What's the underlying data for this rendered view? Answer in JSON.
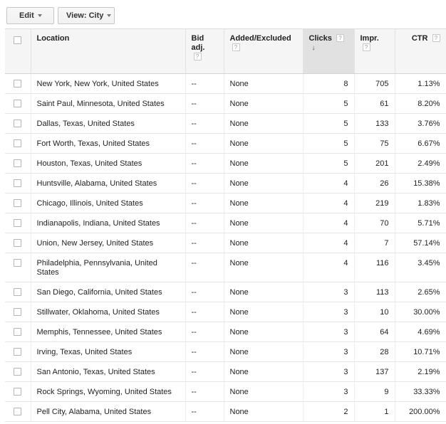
{
  "toolbar": {
    "edit_label": "Edit",
    "view_label": "View: City"
  },
  "table": {
    "headers": {
      "location": "Location",
      "bid_adj": "Bid adj.",
      "added_excluded": "Added/Excluded",
      "clicks": "Clicks",
      "impr": "Impr.",
      "ctr": "CTR"
    },
    "hint_glyph": "?",
    "sort_glyph": "↓",
    "rows": [
      {
        "location": "New York, New York, United States",
        "bid": "--",
        "added": "None",
        "clicks": "8",
        "impr": "705",
        "ctr": "1.13%"
      },
      {
        "location": "Saint Paul, Minnesota, United States",
        "bid": "--",
        "added": "None",
        "clicks": "5",
        "impr": "61",
        "ctr": "8.20%"
      },
      {
        "location": "Dallas, Texas, United States",
        "bid": "--",
        "added": "None",
        "clicks": "5",
        "impr": "133",
        "ctr": "3.76%"
      },
      {
        "location": "Fort Worth, Texas, United States",
        "bid": "--",
        "added": "None",
        "clicks": "5",
        "impr": "75",
        "ctr": "6.67%"
      },
      {
        "location": "Houston, Texas, United States",
        "bid": "--",
        "added": "None",
        "clicks": "5",
        "impr": "201",
        "ctr": "2.49%"
      },
      {
        "location": "Huntsville, Alabama, United States",
        "bid": "--",
        "added": "None",
        "clicks": "4",
        "impr": "26",
        "ctr": "15.38%"
      },
      {
        "location": "Chicago, Illinois, United States",
        "bid": "--",
        "added": "None",
        "clicks": "4",
        "impr": "219",
        "ctr": "1.83%"
      },
      {
        "location": "Indianapolis, Indiana, United States",
        "bid": "--",
        "added": "None",
        "clicks": "4",
        "impr": "70",
        "ctr": "5.71%"
      },
      {
        "location": "Union, New Jersey, United States",
        "bid": "--",
        "added": "None",
        "clicks": "4",
        "impr": "7",
        "ctr": "57.14%"
      },
      {
        "location": "Philadelphia, Pennsylvania, United States",
        "bid": "--",
        "added": "None",
        "clicks": "4",
        "impr": "116",
        "ctr": "3.45%"
      },
      {
        "location": "San Diego, California, United States",
        "bid": "--",
        "added": "None",
        "clicks": "3",
        "impr": "113",
        "ctr": "2.65%"
      },
      {
        "location": "Stillwater, Oklahoma, United States",
        "bid": "--",
        "added": "None",
        "clicks": "3",
        "impr": "10",
        "ctr": "30.00%"
      },
      {
        "location": "Memphis, Tennessee, United States",
        "bid": "--",
        "added": "None",
        "clicks": "3",
        "impr": "64",
        "ctr": "4.69%"
      },
      {
        "location": "Irving, Texas, United States",
        "bid": "--",
        "added": "None",
        "clicks": "3",
        "impr": "28",
        "ctr": "10.71%"
      },
      {
        "location": "San Antonio, Texas, United States",
        "bid": "--",
        "added": "None",
        "clicks": "3",
        "impr": "137",
        "ctr": "2.19%"
      },
      {
        "location": "Rock Springs, Wyoming, United States",
        "bid": "--",
        "added": "None",
        "clicks": "3",
        "impr": "9",
        "ctr": "33.33%"
      },
      {
        "location": "Pell City, Alabama, United States",
        "bid": "--",
        "added": "None",
        "clicks": "2",
        "impr": "1",
        "ctr": "200.00%"
      }
    ]
  }
}
